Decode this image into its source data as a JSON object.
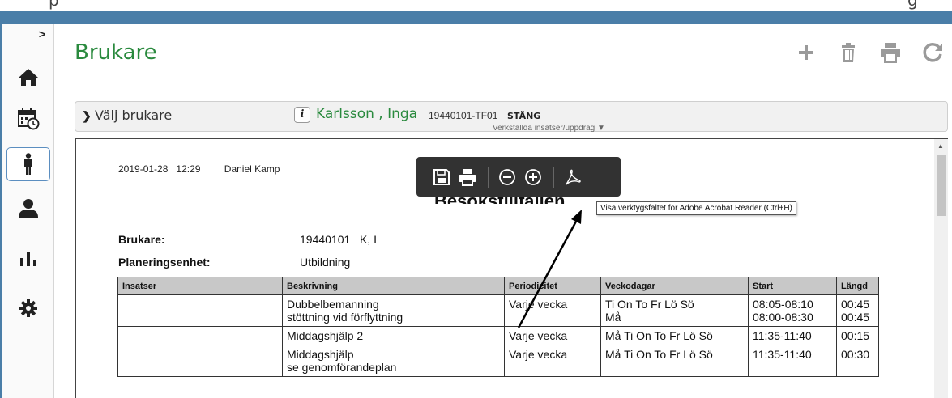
{
  "app": {
    "top_caption_left": "p",
    "top_caption_right": "g"
  },
  "sidebar": {
    "collapse_glyph": ">",
    "items": [
      {
        "icon": "home-icon",
        "active": false
      },
      {
        "icon": "calendar-clock-icon",
        "active": false
      },
      {
        "icon": "person-standing-icon",
        "active": true
      },
      {
        "icon": "user-icon",
        "active": false
      },
      {
        "icon": "bar-chart-icon",
        "active": false
      },
      {
        "icon": "gear-icon",
        "active": false
      }
    ]
  },
  "header": {
    "title": "Brukare",
    "actions": [
      "plus-icon",
      "trash-icon",
      "print-icon",
      "refresh-icon"
    ]
  },
  "select_bar": {
    "label": "Välj brukare",
    "patient_name": "Karlsson , Inga",
    "patient_id": "19440101-TF01",
    "close_label": "STÄNG",
    "sub_label": "Verkställda insatser/uppdrag"
  },
  "document": {
    "date": "2019-01-28",
    "time": "12:29",
    "author": "Daniel Kamp",
    "title": "Besökstillfällen",
    "fields": [
      {
        "key": "Brukare:",
        "value": "19440101   K, I"
      },
      {
        "key": "Planeringsenhet:",
        "value": "Utbildning"
      }
    ],
    "table": {
      "headers": [
        "Insatser",
        "Beskrivning",
        "Periodicitet",
        "Veckodagar",
        "Start",
        "Längd"
      ],
      "rows": [
        [
          "",
          "Dubbelbemanning\nstöttning vid förflyttning",
          "Varje vecka",
          "Ti On To Fr Lö Sö\nMå",
          "08:05-08:10\n08:00-08:30",
          "00:45\n00:45"
        ],
        [
          "",
          "Middagshjälp 2",
          "Varje vecka",
          "Må Ti On To Fr Lö Sö",
          "11:35-11:40",
          "00:15"
        ],
        [
          "",
          "Middagshjälp\nse genomförandeplan",
          "Varje vecka",
          "Må Ti On To Fr Lö Sö",
          "11:35-11:40",
          "00:30"
        ]
      ]
    }
  },
  "pdf_toolbar": {
    "buttons": [
      "save-icon",
      "print-icon",
      "zoom-out-icon",
      "zoom-in-icon",
      "acrobat-icon"
    ],
    "tooltip": "Visa verktygsfältet för Adobe Acrobat Reader (Ctrl+H)"
  },
  "colors": {
    "accent_blue": "#4a7ea8",
    "title_green": "#2a8a3e",
    "pdf_toolbar_bg": "#323232",
    "table_header_bg": "#c8c8c8"
  }
}
